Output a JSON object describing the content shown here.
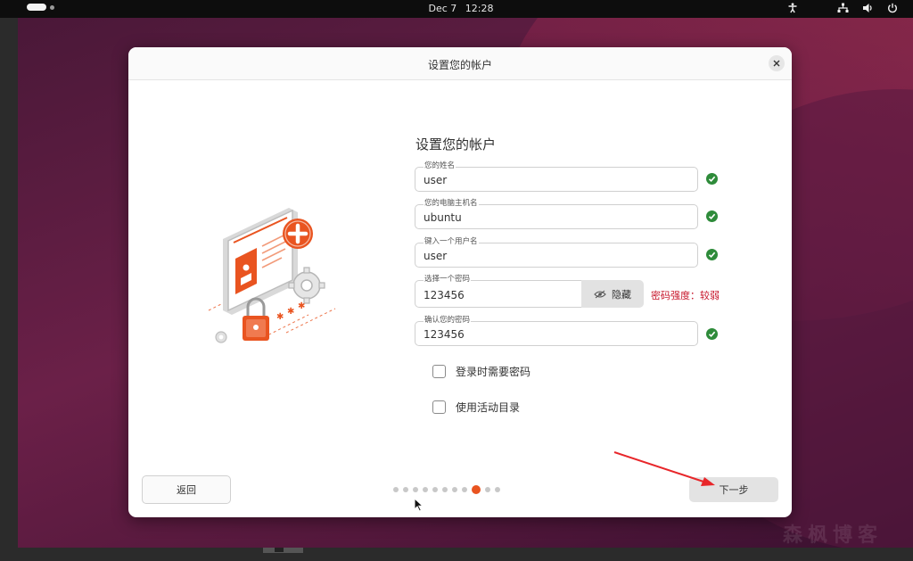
{
  "topbar": {
    "date": "Dec 7",
    "time": "12:28",
    "icons": [
      "accessibility-icon",
      "network-icon",
      "volume-icon",
      "power-icon"
    ]
  },
  "dialog": {
    "title": "设置您的帐户",
    "close_icon": "close-icon"
  },
  "form": {
    "title": "设置您的帐户",
    "fields": [
      {
        "label": "您的姓名",
        "value": "user",
        "valid": true
      },
      {
        "label": "您的电脑主机名",
        "value": "ubuntu",
        "valid": true
      },
      {
        "label": "键入一个用户名",
        "value": "user",
        "valid": true
      },
      {
        "label": "选择一个密码",
        "value": "123456",
        "valid": false
      },
      {
        "label": "确认您的密码",
        "value": "123456",
        "valid": true
      }
    ],
    "hide_button": "隐藏",
    "password_strength": "密码强度：较弱",
    "checkboxes": [
      {
        "label": "登录时需要密码",
        "checked": false
      },
      {
        "label": "使用活动目录",
        "checked": false
      }
    ]
  },
  "footer": {
    "back_label": "返回",
    "next_label": "下一步",
    "step_total": 11,
    "step_active": 9
  },
  "colors": {
    "accent": "#e95420",
    "check_green": "#2e8b3a",
    "strength_red": "#c7162b",
    "annotation_arrow": "#e8262a"
  },
  "watermark": "森枫博客"
}
